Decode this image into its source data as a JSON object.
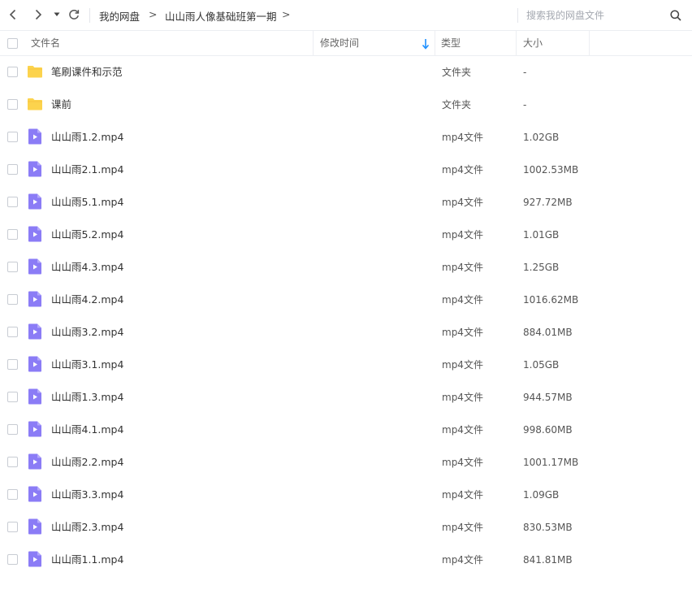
{
  "toolbar": {
    "breadcrumb": [
      "我的网盘",
      "山山雨人像基础班第一期"
    ],
    "breadcrumb_separator": ">",
    "search_placeholder": "搜索我的网盘文件"
  },
  "columns": {
    "name": "文件名",
    "modified": "修改时间",
    "type": "类型",
    "size": "大小"
  },
  "colors": {
    "folder": "#fcd34d",
    "video_icon": "#8b7cf6",
    "sort_arrow": "#1e90ff"
  },
  "files": [
    {
      "name": "笔刷课件和示范",
      "type": "文件夹",
      "size": "-",
      "icon": "folder-icon"
    },
    {
      "name": "课前",
      "type": "文件夹",
      "size": "-",
      "icon": "folder-icon"
    },
    {
      "name": "山山雨1.2.mp4",
      "type": "mp4文件",
      "size": "1.02GB",
      "icon": "video-file-icon"
    },
    {
      "name": "山山雨2.1.mp4",
      "type": "mp4文件",
      "size": "1002.53MB",
      "icon": "video-file-icon"
    },
    {
      "name": "山山雨5.1.mp4",
      "type": "mp4文件",
      "size": "927.72MB",
      "icon": "video-file-icon"
    },
    {
      "name": "山山雨5.2.mp4",
      "type": "mp4文件",
      "size": "1.01GB",
      "icon": "video-file-icon"
    },
    {
      "name": "山山雨4.3.mp4",
      "type": "mp4文件",
      "size": "1.25GB",
      "icon": "video-file-icon"
    },
    {
      "name": "山山雨4.2.mp4",
      "type": "mp4文件",
      "size": "1016.62MB",
      "icon": "video-file-icon"
    },
    {
      "name": "山山雨3.2.mp4",
      "type": "mp4文件",
      "size": "884.01MB",
      "icon": "video-file-icon"
    },
    {
      "name": "山山雨3.1.mp4",
      "type": "mp4文件",
      "size": "1.05GB",
      "icon": "video-file-icon"
    },
    {
      "name": "山山雨1.3.mp4",
      "type": "mp4文件",
      "size": "944.57MB",
      "icon": "video-file-icon"
    },
    {
      "name": "山山雨4.1.mp4",
      "type": "mp4文件",
      "size": "998.60MB",
      "icon": "video-file-icon"
    },
    {
      "name": "山山雨2.2.mp4",
      "type": "mp4文件",
      "size": "1001.17MB",
      "icon": "video-file-icon"
    },
    {
      "name": "山山雨3.3.mp4",
      "type": "mp4文件",
      "size": "1.09GB",
      "icon": "video-file-icon"
    },
    {
      "name": "山山雨2.3.mp4",
      "type": "mp4文件",
      "size": "830.53MB",
      "icon": "video-file-icon"
    },
    {
      "name": "山山雨1.1.mp4",
      "type": "mp4文件",
      "size": "841.81MB",
      "icon": "video-file-icon"
    }
  ]
}
